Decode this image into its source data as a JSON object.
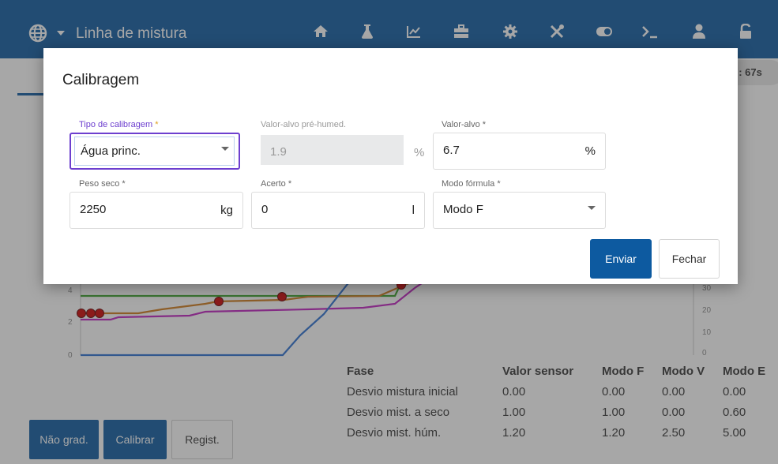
{
  "header": {
    "title": "Linha de mistura",
    "nav_icons": [
      "home-icon",
      "flask-icon",
      "chart-icon",
      "toolbox-icon",
      "gear-icon",
      "tools-icon",
      "toggle-icon",
      "terminal-icon",
      "user-icon",
      "lock-icon"
    ]
  },
  "background": {
    "timer_pill": "l : 67s",
    "axis_left_ticks": [
      "4",
      "2",
      "0"
    ],
    "axis_right_ticks": [
      "30",
      "20",
      "10",
      "0"
    ],
    "table": {
      "headers": [
        "Fase",
        "Valor sensor",
        "Modo F",
        "Modo V",
        "Modo E"
      ],
      "rows": [
        [
          "Desvio mistura inicial",
          "0.00",
          "0.00",
          "0.00",
          "0.00"
        ],
        [
          "Desvio mist. a seco",
          "1.00",
          "1.00",
          "0.00",
          "0.60"
        ],
        [
          "Desvio mist. húm.",
          "1.20",
          "1.20",
          "2.50",
          "5.00"
        ]
      ]
    },
    "buttons": {
      "nao_grad": "Não grad.",
      "calibrar": "Calibrar",
      "regist": "Regist."
    },
    "colors": {
      "accent": "#0d5aa0",
      "line_blue": "#2a6fd1",
      "line_green": "#3aa02a",
      "line_orange": "#d07a1a",
      "line_magenta": "#c020c0",
      "marker_red": "#cc0000"
    }
  },
  "dialog": {
    "title": "Calibragem",
    "fields": {
      "tipo": {
        "label": "Tipo de calibragem",
        "req": " *",
        "value": "Água princ."
      },
      "pre_humed": {
        "label": "Valor-alvo pré-humed.",
        "value": "1.9",
        "unit": "%"
      },
      "valor_alvo": {
        "label": "Valor-alvo",
        "req": " *",
        "value": "6.7",
        "unit": "%"
      },
      "peso_seco": {
        "label": "Peso seco",
        "req": " *",
        "value": "2250",
        "unit": "kg"
      },
      "acerto": {
        "label": "Acerto",
        "req": " *",
        "value": "0",
        "unit": "l"
      },
      "modo_formula": {
        "label": "Modo fórmula",
        "req": " *",
        "value": "Modo F"
      }
    },
    "buttons": {
      "submit": "Enviar",
      "close": "Fechar"
    }
  }
}
